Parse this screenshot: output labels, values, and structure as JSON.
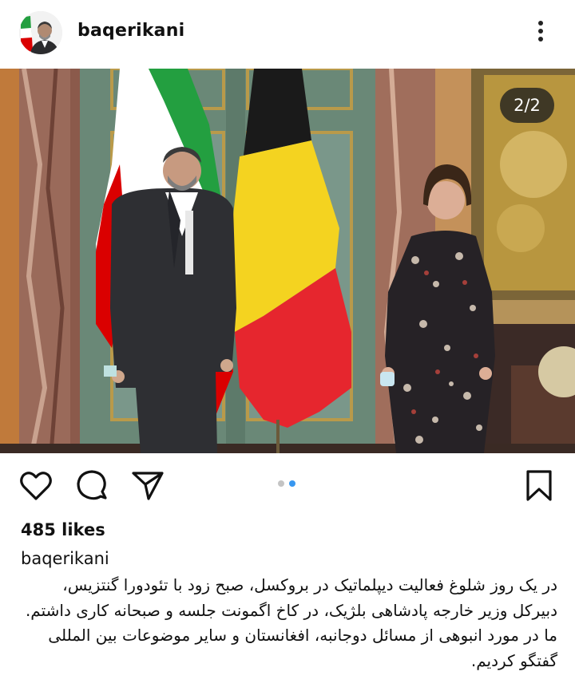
{
  "post": {
    "username": "baqerikani",
    "image_counter": "2/2",
    "likes": "485 likes",
    "caption_username": "baqerikani",
    "caption_text": "در یک روز شلوغ فعالیت دیپلماتیک در بروکسل، صبح زود با تئودورا گنتزیس، دبیرکل وزیر خارجه پادشاهی بلژیک، در کاخ اگمونت جلسه و صبحانه کاری داشتم. ما در مورد انبوهی از مسائل دوجانبه، افغانستان و سایر موضوعات بین المللی گفتگو کردیم."
  },
  "carousel": {
    "current_slide": 2,
    "total_slides": 2,
    "active_dot_color": "#3897f0",
    "inactive_dot_color": "#c4c4c4"
  },
  "icons": [
    "more-options-icon",
    "heart-icon",
    "comment-icon",
    "share-icon",
    "bookmark-icon"
  ]
}
